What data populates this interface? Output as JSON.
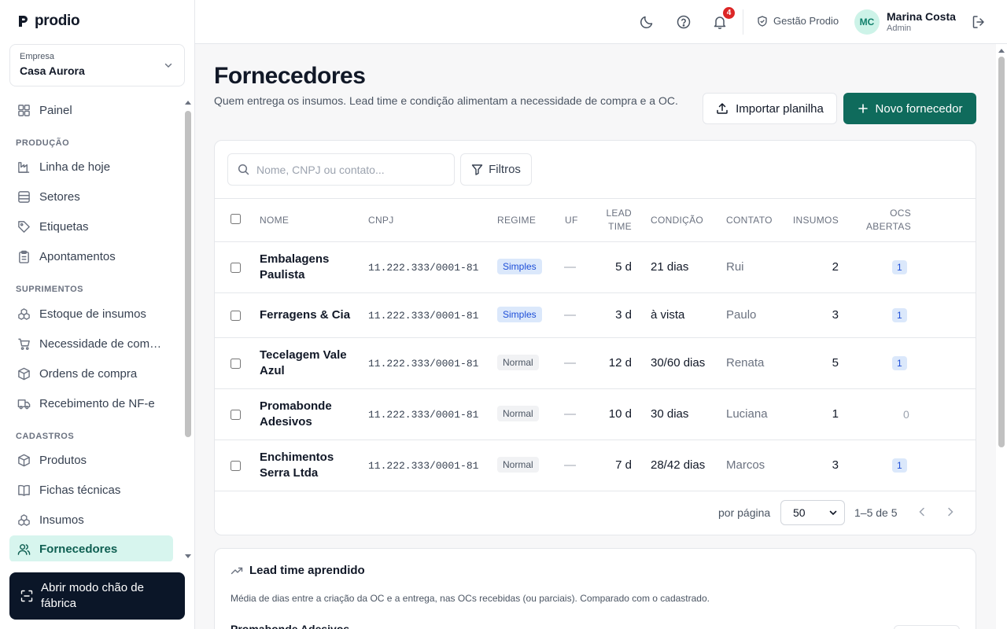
{
  "brand": {
    "name": "prodio"
  },
  "company": {
    "label": "Empresa",
    "value": "Casa Aurora"
  },
  "sidebar": {
    "painel": "Painel",
    "sections": {
      "producao": "PRODUÇÃO",
      "suprimentos": "SUPRIMENTOS",
      "cadastros": "CADASTROS"
    },
    "items": {
      "linha_hoje": "Linha de hoje",
      "setores": "Setores",
      "etiquetas": "Etiquetas",
      "apontamentos": "Apontamentos",
      "estoque": "Estoque de insumos",
      "necessidade": "Necessidade de compra",
      "ordens": "Ordens de compra",
      "recebimento": "Recebimento de NF-e",
      "produtos": "Produtos",
      "fichas": "Fichas técnicas",
      "insumos": "Insumos",
      "fornecedores": "Fornecedores"
    },
    "factory_button": "Abrir modo chão de fábrica"
  },
  "topbar": {
    "notifications_count": "4",
    "org_label": "Gestão Prodio",
    "user": {
      "initials": "MC",
      "name": "Marina Costa",
      "role": "Admin"
    }
  },
  "page": {
    "title": "Fornecedores",
    "description": "Quem entrega os insumos. Lead time e condição alimentam a necessidade de compra e a OC.",
    "import_button": "Importar planilha",
    "new_button": "Novo fornecedor"
  },
  "toolbar": {
    "search_placeholder": "Nome, CNPJ ou contato...",
    "filters_label": "Filtros"
  },
  "table": {
    "headers": {
      "nome": "NOME",
      "cnpj": "CNPJ",
      "regime": "REGIME",
      "uf": "UF",
      "lead1": "LEAD",
      "lead2": "TIME",
      "condicao": "CONDIÇÃO",
      "contato": "CONTATO",
      "insumos": "INSUMOS",
      "ocs1": "OCS",
      "ocs2": "ABERTAS"
    },
    "rows": [
      {
        "nome": "Embalagens Paulista",
        "cnpj": "11.222.333/0001-81",
        "regime": "Simples",
        "uf": "—",
        "lead": "5 d",
        "condicao": "21 dias",
        "contato": "Rui",
        "insumos": "2",
        "ocs": "1"
      },
      {
        "nome": "Ferragens & Cia",
        "cnpj": "11.222.333/0001-81",
        "regime": "Simples",
        "uf": "—",
        "lead": "3 d",
        "condicao": "à vista",
        "contato": "Paulo",
        "insumos": "3",
        "ocs": "1"
      },
      {
        "nome": "Tecelagem Vale Azul",
        "cnpj": "11.222.333/0001-81",
        "regime": "Normal",
        "uf": "—",
        "lead": "12 d",
        "condicao": "30/60 dias",
        "contato": "Renata",
        "insumos": "5",
        "ocs": "1"
      },
      {
        "nome": "Promabonde Adesivos",
        "cnpj": "11.222.333/0001-81",
        "regime": "Normal",
        "uf": "—",
        "lead": "10 d",
        "condicao": "30 dias",
        "contato": "Luciana",
        "insumos": "1",
        "ocs": "0"
      },
      {
        "nome": "Enchimentos Serra Ltda",
        "cnpj": "11.222.333/0001-81",
        "regime": "Normal",
        "uf": "—",
        "lead": "7 d",
        "condicao": "28/42 dias",
        "contato": "Marcos",
        "insumos": "3",
        "ocs": "1"
      }
    ]
  },
  "pagination": {
    "per_page_label": "por página",
    "per_page_value": "50",
    "range": "1–5 de 5"
  },
  "lead_card": {
    "title": "Lead time aprendido",
    "description": "Média de dias entre a criação da OC e a entrega, nas OCs recebidas (ou parciais). Comparado com o cadastrado.",
    "first_item": "Promabonde Adesivos"
  },
  "colors": {
    "accent": "#0f6b5c",
    "active_bg": "#d7f5ee",
    "badge": "#dc2626"
  }
}
